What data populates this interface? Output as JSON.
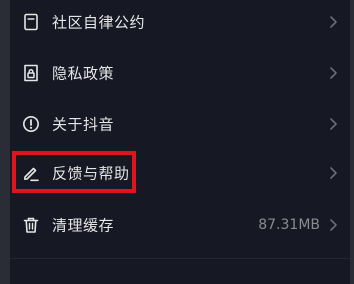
{
  "settings": {
    "items": [
      {
        "label": "社区自律公约",
        "icon": "document-icon"
      },
      {
        "label": "隐私政策",
        "icon": "lock-document-icon"
      },
      {
        "label": "关于抖音",
        "icon": "info-circle-icon"
      },
      {
        "label": "反馈与帮助",
        "icon": "pen-icon"
      },
      {
        "label": "清理缓存",
        "icon": "trash-icon",
        "value": "87.31MB"
      }
    ]
  },
  "colors": {
    "background": "#161823",
    "text": "#e6e6e8",
    "muted": "#8a8b91",
    "highlight": "#e0141e"
  }
}
